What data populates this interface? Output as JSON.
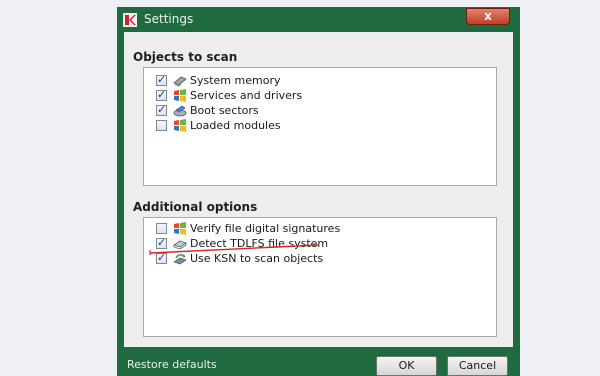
{
  "window": {
    "title": "Settings",
    "close_label": "x"
  },
  "objects_to_scan": {
    "heading": "Objects to scan",
    "items": [
      {
        "label": "System memory",
        "checked": true,
        "icon": "memory-chip-icon"
      },
      {
        "label": "Services and drivers",
        "checked": true,
        "icon": "windows-logo-icon"
      },
      {
        "label": "Boot sectors",
        "checked": true,
        "icon": "boot-disk-icon"
      },
      {
        "label": "Loaded modules",
        "checked": false,
        "icon": "windows-logo-icon"
      }
    ]
  },
  "additional_options": {
    "heading": "Additional options",
    "items": [
      {
        "label": "Verify file digital signatures",
        "checked": false,
        "icon": "windows-logo-icon"
      },
      {
        "label": "Detect TDLFS file system",
        "checked": true,
        "icon": "hard-drive-icon"
      },
      {
        "label": "Use KSN to scan objects",
        "checked": true,
        "icon": "ksn-network-icon"
      }
    ]
  },
  "footer": {
    "restore_defaults": "Restore defaults",
    "ok_label": "OK",
    "cancel_label": "Cancel"
  },
  "checkmark": "✓",
  "colors": {
    "window_frame": "#1f6a3e",
    "client_bg": "#ededed",
    "annotation": "#d8252a"
  }
}
